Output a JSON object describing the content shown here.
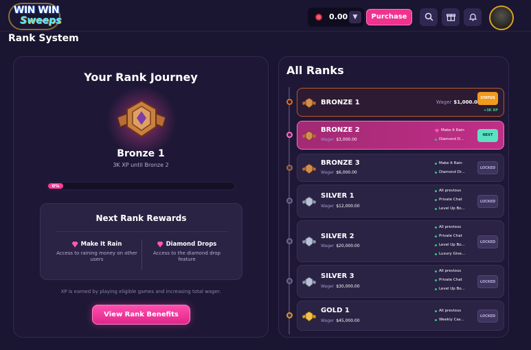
{
  "header": {
    "logo_line1": "WIN WIN",
    "logo_line2": "Sweeps",
    "balance": "0.00",
    "balance_dropdown_icon": "chevron-down-icon",
    "purchase_label": "Purchase",
    "icons": [
      "search-icon",
      "gift-icon",
      "bell-icon"
    ],
    "accent_color": "#f1328f"
  },
  "page": {
    "title": "Rank System"
  },
  "journey": {
    "title": "Your Rank Journey",
    "current_rank": "Bronze 1",
    "xp_text": "3K XP until Bronze 2",
    "progress_percent": 0,
    "progress_label": "0%",
    "rewards_title": "Next Rank Rewards",
    "rewards": [
      {
        "name": "Make It Rain",
        "desc": "Access to raining money on other users"
      },
      {
        "name": "Diamond Drops",
        "desc": "Access to the diamond drop feature"
      }
    ],
    "footnote": "XP is earned by playing eligible games and increasing total wager.",
    "view_benefits_label": "View Rank Benefits"
  },
  "all_ranks": {
    "title": "All Ranks",
    "wager_label": "Wager",
    "ranks": [
      {
        "name": "BRONZE 1",
        "wager": "$1,000.00",
        "state": "STATUS",
        "gain": "+3K XP",
        "rewards": []
      },
      {
        "name": "BRONZE 2",
        "wager": "$3,000.00",
        "state": "NEXT",
        "rewards": [
          "Make It Rain",
          "Diamond D..."
        ]
      },
      {
        "name": "BRONZE 3",
        "wager": "$6,000.00",
        "state": "LOCKED",
        "rewards": [
          "Make It Rain",
          "Diamond Dr..."
        ]
      },
      {
        "name": "SILVER 1",
        "wager": "$12,000.00",
        "state": "LOCKED",
        "rewards": [
          "All previous",
          "Private Chat",
          "Level Up Bo..."
        ]
      },
      {
        "name": "SILVER 2",
        "wager": "$20,000.00",
        "state": "LOCKED",
        "rewards": [
          "All previous",
          "Private Chat",
          "Level Up Bo...",
          "Luxury Give..."
        ]
      },
      {
        "name": "SILVER 3",
        "wager": "$30,000.00",
        "state": "LOCKED",
        "rewards": [
          "All previous",
          "Private Chat",
          "Level Up Bo..."
        ]
      },
      {
        "name": "GOLD 1",
        "wager": "$45,000.00",
        "state": "LOCKED",
        "rewards": [
          "All previous",
          "Weekly Cas..."
        ]
      }
    ]
  }
}
